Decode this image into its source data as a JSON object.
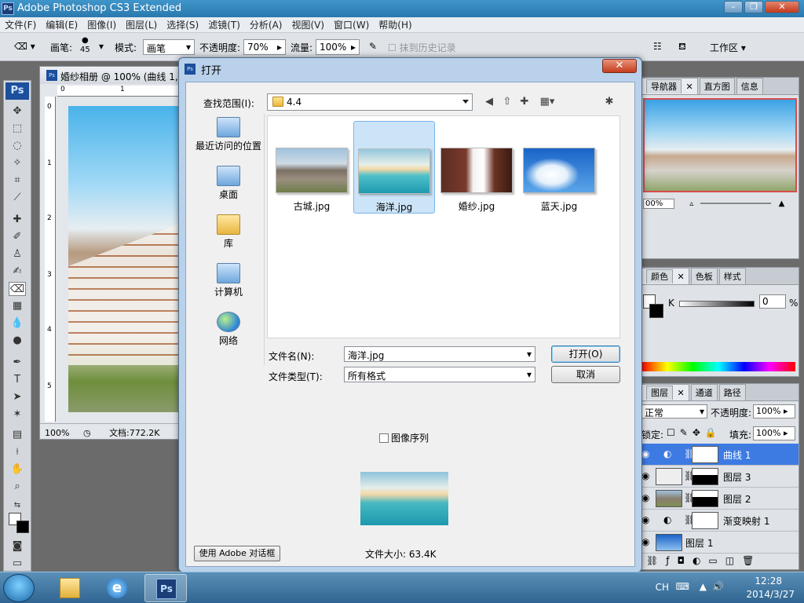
{
  "app": {
    "title": "Adobe Photoshop CS3 Extended",
    "logo": "Ps"
  },
  "menu": [
    "文件(F)",
    "编辑(E)",
    "图像(I)",
    "图层(L)",
    "选择(S)",
    "滤镜(T)",
    "分析(A)",
    "视图(V)",
    "窗口(W)",
    "帮助(H)"
  ],
  "options": {
    "brush_label": "画笔:",
    "brush_size": "45",
    "mode_label": "模式:",
    "mode_value": "画笔",
    "opacity_label": "不透明度:",
    "opacity_value": "70%",
    "flow_label": "流量:",
    "flow_value": "100%",
    "history_label": "抹到历史记录",
    "workspace_label": "工作区"
  },
  "document": {
    "title": "婚纱相册 @ 100% (曲线 1,",
    "zoom": "100%",
    "doc_size": "文档:772.2K",
    "ruler_top": [
      "0",
      "1"
    ],
    "ruler_left": [
      "0",
      "1",
      "2",
      "3",
      "4",
      "5"
    ]
  },
  "panels": {
    "nav_tabs": [
      "导航器",
      "直方图",
      "信息"
    ],
    "nav_zoom": "00%",
    "color_tabs": [
      "颜色",
      "色板",
      "样式"
    ],
    "color_k_label": "K",
    "color_k_value": "0",
    "color_k_unit": "%",
    "layer_tabs": [
      "图层",
      "通道",
      "路径"
    ],
    "blend_mode": "正常",
    "opacity_label": "不透明度:",
    "opacity_value": "100%",
    "lock_label": "锁定:",
    "fill_label": "填充:",
    "fill_value": "100%",
    "layers": [
      {
        "name": "曲线 1",
        "selected": true
      },
      {
        "name": "图层 3",
        "selected": false
      },
      {
        "name": "图层 2",
        "selected": false
      },
      {
        "name": "渐变映射 1",
        "selected": false
      },
      {
        "name": "图层 1",
        "selected": false
      }
    ]
  },
  "dialog": {
    "title": "打开",
    "close": "✕",
    "lookin_label": "查找范围(I):",
    "lookin_value": "4.4",
    "places": [
      "最近访问的位置",
      "桌面",
      "库",
      "计算机",
      "网络"
    ],
    "files": [
      {
        "name": "古城.jpg",
        "selected": false
      },
      {
        "name": "海洋.jpg",
        "selected": true
      },
      {
        "name": "婚纱.jpg",
        "selected": false
      },
      {
        "name": "蓝天.jpg",
        "selected": false
      }
    ],
    "filename_label": "文件名(N):",
    "filename_value": "海洋.jpg",
    "filetype_label": "文件类型(T):",
    "filetype_value": "所有格式",
    "open_button": "打开(O)",
    "cancel_button": "取消",
    "image_sequence": "图像序列",
    "file_size": "文件大小: 63.4K",
    "adobe_dialog_button": "使用 Adobe 对话框"
  },
  "taskbar": {
    "lang": "CH",
    "time": "12:28",
    "date": "2014/3/27",
    "ps_label": "Ps"
  }
}
